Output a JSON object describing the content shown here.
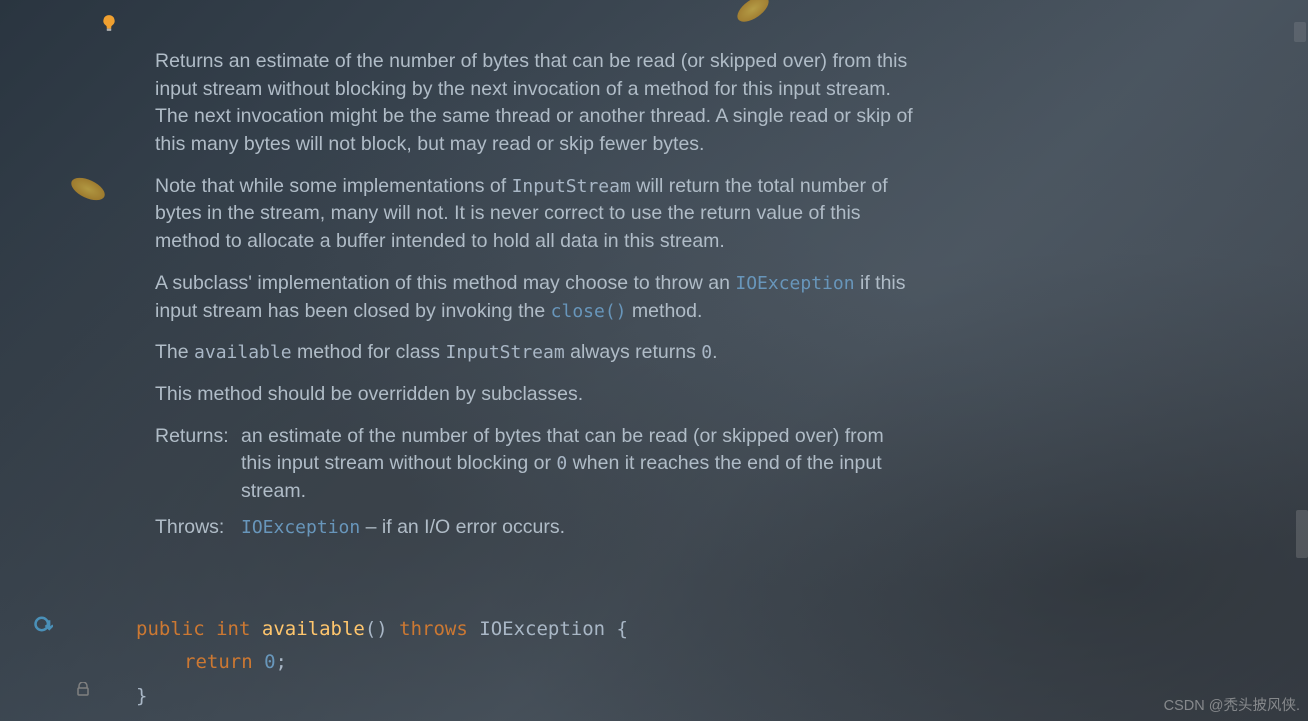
{
  "doc": {
    "p1": "Returns an estimate of the number of bytes that can be read (or skipped over) from this input stream without blocking by the next invocation of a method for this input stream. The next invocation might be the same thread or another thread. A single read or skip of this many bytes will not block, but may read or skip fewer bytes.",
    "p2_pre": "Note that while some implementations of ",
    "p2_code": "InputStream",
    "p2_post": " will return the total number of bytes in the stream, many will not. It is never correct to use the return value of this method to allocate a buffer intended to hold all data in this stream.",
    "p3_pre": "A subclass' implementation of this method may choose to throw an ",
    "p3_code1": "IOException",
    "p3_mid": " if this input stream has been closed by invoking the ",
    "p3_code2": "close()",
    "p3_post": " method.",
    "p4_pre": "The ",
    "p4_code1": "available",
    "p4_mid1": " method for class ",
    "p4_code2": "InputStream",
    "p4_mid2": " always returns ",
    "p4_code3": "0",
    "p4_post": ".",
    "p5": "This method should be overridden by subclasses.",
    "returns_label": "Returns:",
    "returns_body_pre": "an estimate of the number of bytes that can be read (or skipped over) from this input stream without blocking or ",
    "returns_body_code": "0",
    "returns_body_post": " when it reaches the end of the input stream.",
    "throws_label": "Throws:",
    "throws_code": "IOException",
    "throws_body": " – if an I/O error occurs."
  },
  "code": {
    "kw_public": "public",
    "kw_int": "int",
    "method": "available",
    "parens": "()",
    "kw_throws": "throws",
    "exc": "IOException",
    "brace_open": " {",
    "kw_return": "return",
    "zero": "0",
    "semi": ";",
    "brace_close": "}"
  },
  "watermark": "CSDN @秃头披风侠."
}
